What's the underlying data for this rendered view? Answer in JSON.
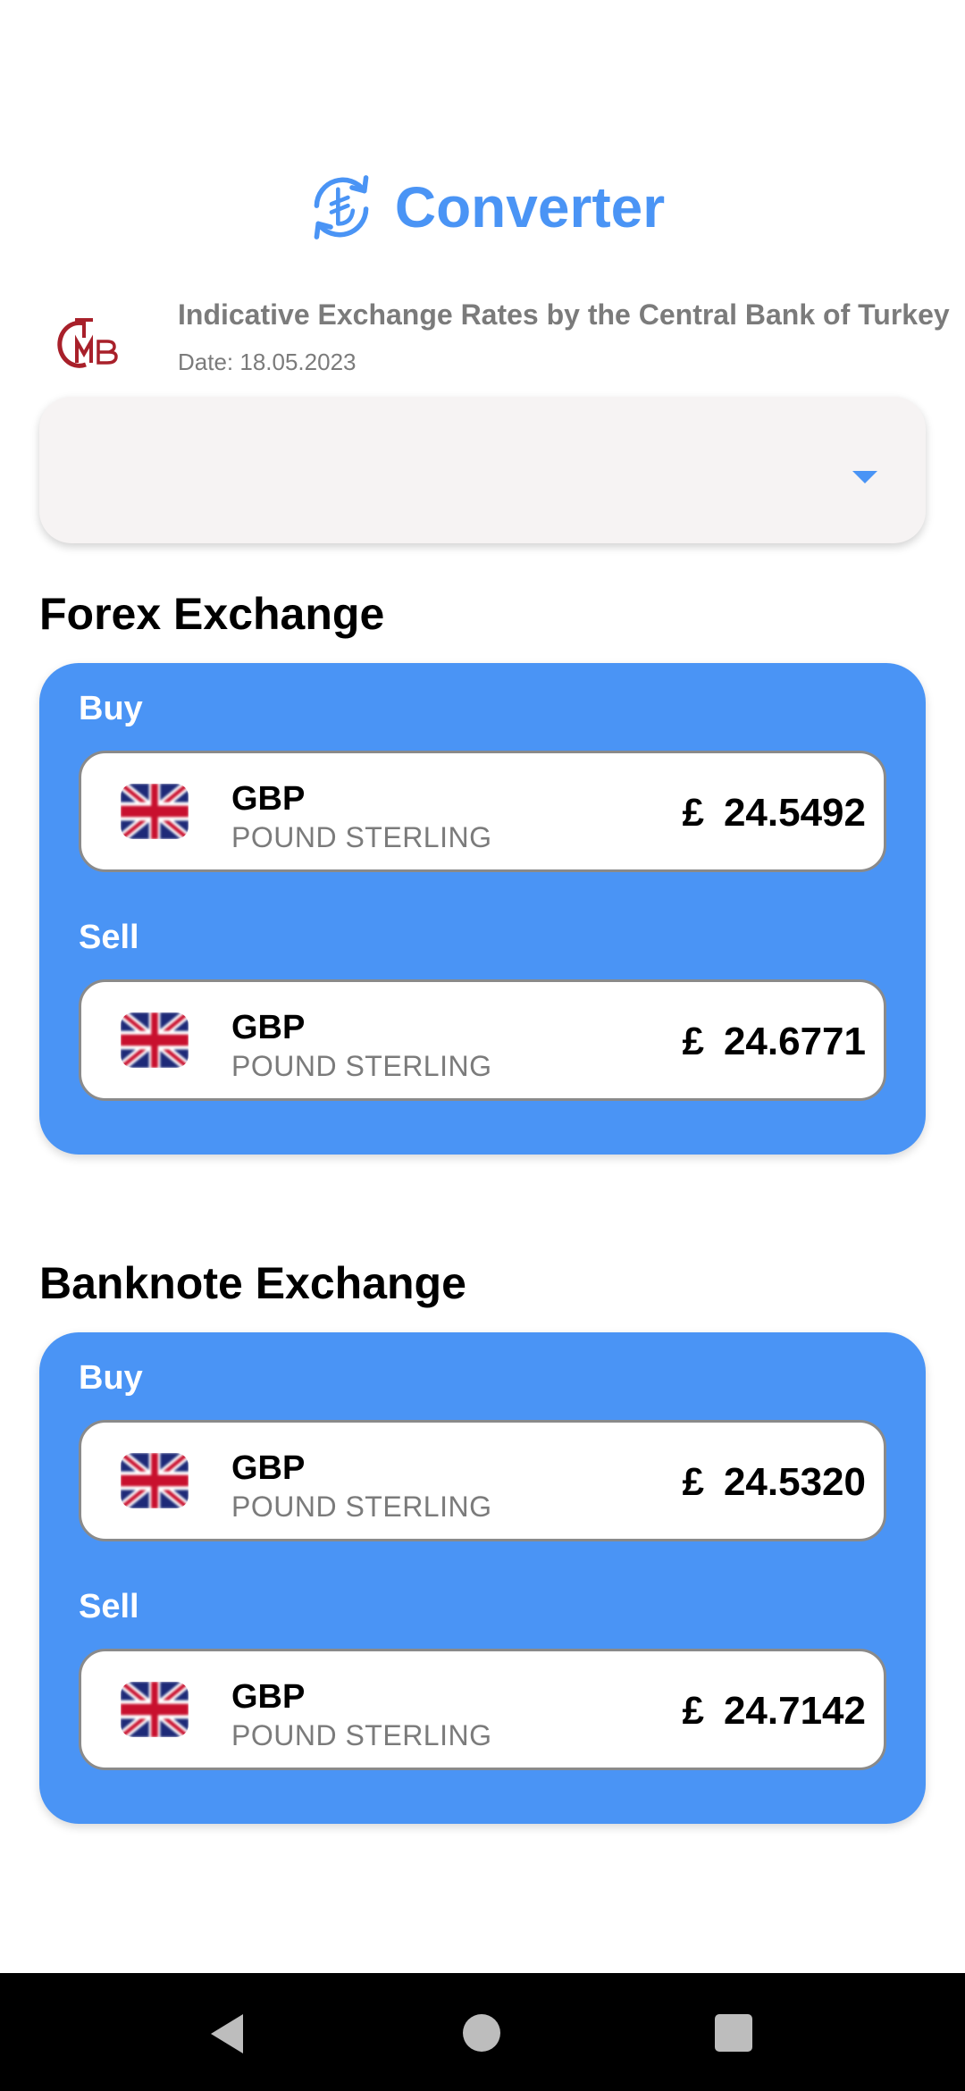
{
  "header": {
    "title": "Converter",
    "logo_icon": "lira-exchange-icon"
  },
  "bank": {
    "logo_icon": "tcmb-logo",
    "name": "Indicative Exchange Rates by the Central Bank of Turkey",
    "date": "Date: 18.05.2023"
  },
  "dropdown": {
    "value": "",
    "arrow_icon": "dropdown-arrow-icon"
  },
  "forex": {
    "title": "Forex Exchange",
    "buy": {
      "label": "Buy",
      "code": "GBP",
      "name": "POUND STERLING",
      "symbol": "£",
      "rate": "24.5492"
    },
    "sell": {
      "label": "Sell",
      "code": "GBP",
      "name": "POUND STERLING",
      "symbol": "£",
      "rate": "24.6771"
    }
  },
  "banknote": {
    "title": "Banknote Exchange",
    "buy": {
      "label": "Buy",
      "code": "GBP",
      "name": "POUND STERLING",
      "symbol": "£",
      "rate": "24.5320"
    },
    "sell": {
      "label": "Sell",
      "code": "GBP",
      "name": "POUND STERLING",
      "symbol": "£",
      "rate": "24.7142"
    }
  },
  "colors": {
    "accent": "#4a94f5",
    "tcmb_red": "#a8202a"
  },
  "navbar": {
    "back_icon": "back-icon",
    "home_icon": "home-icon",
    "recents_icon": "recents-icon"
  }
}
